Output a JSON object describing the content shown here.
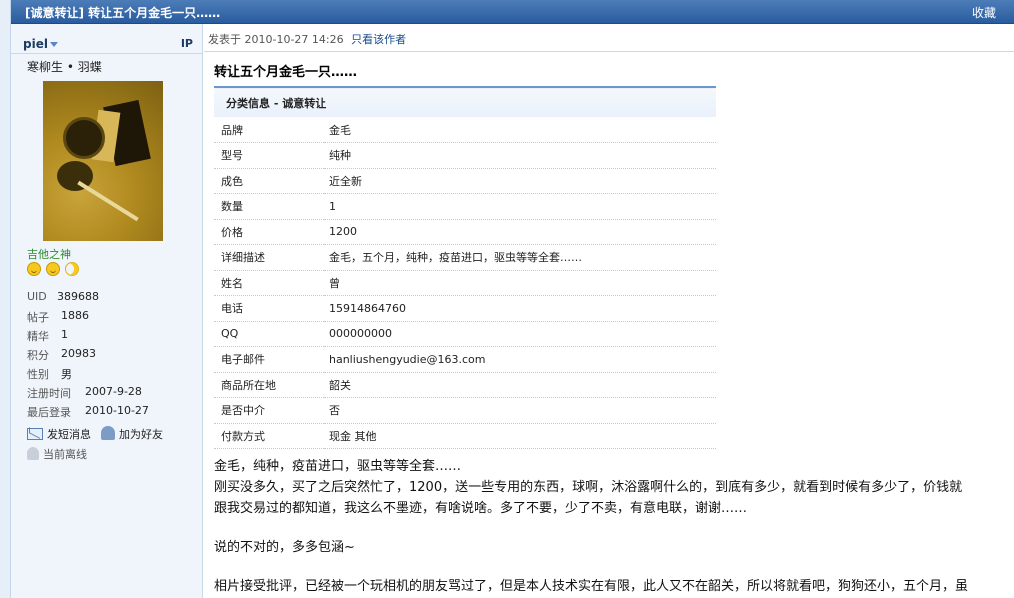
{
  "titlebar": {
    "thread_title": "[诚意转让] 转让五个月金毛一只……",
    "favorite": "收藏"
  },
  "author": {
    "name": "piel",
    "ip_label": "IP",
    "custom_title": "寒柳生 • 羽蝶",
    "rank": "吉他之神",
    "stats": [
      {
        "key": "UID",
        "value": "389688"
      },
      {
        "key": "帖子",
        "value": "1886"
      },
      {
        "key": "精华",
        "value": "1"
      },
      {
        "key": "积分",
        "value": "20983"
      },
      {
        "key": "性别",
        "value": "男"
      },
      {
        "key": "注册时间",
        "value": "2007-9-28"
      },
      {
        "key": "最后登录",
        "value": "2010-10-27"
      }
    ],
    "actions": {
      "send_message": "发短消息",
      "add_friend": "加为好友",
      "status": "当前离线"
    }
  },
  "post": {
    "posted_label": "发表于",
    "posted_time": "2010-10-27 14:26",
    "author_only": "只看该作者",
    "title": "转让五个月金毛一只……",
    "info_header": "分类信息 - 诚意转让",
    "info_rows": [
      {
        "key": "品牌",
        "value": "金毛"
      },
      {
        "key": "型号",
        "value": "纯种"
      },
      {
        "key": "成色",
        "value": "近全新"
      },
      {
        "key": "数量",
        "value": "1"
      },
      {
        "key": "价格",
        "value": "1200"
      },
      {
        "key": "详细描述",
        "value": "金毛，五个月，纯种，疫苗进口，驱虫等等全套……"
      },
      {
        "key": "姓名",
        "value": "曾"
      },
      {
        "key": "电话",
        "value": "15914864760"
      },
      {
        "key": "QQ",
        "value": "000000000"
      },
      {
        "key": "电子邮件",
        "value": "hanliushengyudie@163.com"
      },
      {
        "key": "商品所在地",
        "value": "韶关"
      },
      {
        "key": "是否中介",
        "value": "否"
      },
      {
        "key": "付款方式",
        "value": "现金 其他"
      }
    ],
    "body": {
      "line1": "金毛，纯种，疫苗进口，驱虫等等全套……",
      "line2": "刚买没多久，买了之后突然忙了，1200，送一些专用的东西，球啊，沐浴露啊什么的，到底有多少，就看到时候有多少了，价钱就",
      "line3": "跟我交易过的都知道，我这么不墨迹，有啥说啥。多了不要，少了不卖，有意电联，谢谢……",
      "line4": "说的不对的，多多包涵~",
      "line5": "相片接受批评，已经被一个玩相机的朋友骂过了，但是本人技术实在有限，此人又不在韶关，所以将就看吧，狗狗还小，五个月，虽"
    }
  }
}
